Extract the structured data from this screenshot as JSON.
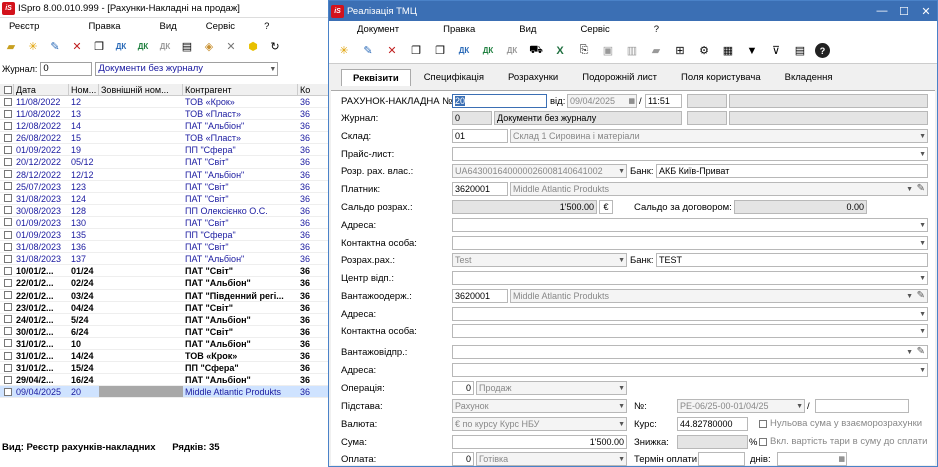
{
  "browse": {
    "title": "ISpro 8.00.010.999 - [Рахунки-Накладні на продаж]",
    "menu": [
      "Реєстр",
      "Правка",
      "Вид",
      "Сервіс",
      "?"
    ],
    "journal_label": "Журнал:",
    "journal_code": "0",
    "journal_name": "Документи без журналу",
    "columns": [
      "Дата",
      "Ном...",
      "Зовнішній ном...",
      "Контрагент",
      "Ко"
    ],
    "rows": [
      {
        "date": "11/08/2022",
        "num": "12",
        "ext": "",
        "contr": "ТОВ «Крок»",
        "ko": "36",
        "bold": false
      },
      {
        "date": "11/08/2022",
        "num": "13",
        "ext": "",
        "contr": "ТОВ «Пласт»",
        "ko": "36",
        "bold": false
      },
      {
        "date": "12/08/2022",
        "num": "14",
        "ext": "",
        "contr": "ПАТ \"Альбіон\"",
        "ko": "36",
        "bold": false
      },
      {
        "date": "26/08/2022",
        "num": "15",
        "ext": "",
        "contr": "ТОВ «Пласт»",
        "ko": "36",
        "bold": false
      },
      {
        "date": "01/09/2022",
        "num": "19",
        "ext": "",
        "contr": "ПП \"Сфера\"",
        "ko": "36",
        "bold": false
      },
      {
        "date": "20/12/2022",
        "num": "05/12",
        "ext": "",
        "contr": "ПАТ \"Світ\"",
        "ko": "36",
        "bold": false
      },
      {
        "date": "28/12/2022",
        "num": "12/12",
        "ext": "",
        "contr": "ПАТ \"Альбіон\"",
        "ko": "36",
        "bold": false
      },
      {
        "date": "25/07/2023",
        "num": "123",
        "ext": "",
        "contr": "ПАТ \"Світ\"",
        "ko": "36",
        "bold": false
      },
      {
        "date": "31/08/2023",
        "num": "124",
        "ext": "",
        "contr": "ПАТ \"Світ\"",
        "ko": "36",
        "bold": false
      },
      {
        "date": "30/08/2023",
        "num": "128",
        "ext": "",
        "contr": "ПП Олексієнко О.С.",
        "ko": "36",
        "bold": false
      },
      {
        "date": "01/09/2023",
        "num": "130",
        "ext": "",
        "contr": "ПАТ \"Світ\"",
        "ko": "36",
        "bold": false
      },
      {
        "date": "01/09/2023",
        "num": "135",
        "ext": "",
        "contr": "ПП \"Сфера\"",
        "ko": "36",
        "bold": false
      },
      {
        "date": "31/08/2023",
        "num": "136",
        "ext": "",
        "contr": "ПАТ \"Світ\"",
        "ko": "36",
        "bold": false
      },
      {
        "date": "31/08/2023",
        "num": "137",
        "ext": "",
        "contr": "ПАТ \"Альбіон\"",
        "ko": "36",
        "bold": false
      },
      {
        "date": "10/01/2...",
        "num": "01/24",
        "ext": "",
        "contr": "ПАТ \"Світ\"",
        "ko": "36",
        "bold": true
      },
      {
        "date": "22/01/2...",
        "num": "02/24",
        "ext": "",
        "contr": "ПАТ \"Альбіон\"",
        "ko": "36",
        "bold": true
      },
      {
        "date": "22/01/2...",
        "num": "03/24",
        "ext": "",
        "contr": "ПАТ \"Південний регі...",
        "ko": "36",
        "bold": true
      },
      {
        "date": "23/01/2...",
        "num": "04/24",
        "ext": "",
        "contr": "ПАТ \"Світ\"",
        "ko": "36",
        "bold": true
      },
      {
        "date": "24/01/2...",
        "num": "5/24",
        "ext": "",
        "contr": "ПАТ \"Альбіон\"",
        "ko": "36",
        "bold": true
      },
      {
        "date": "30/01/2...",
        "num": "6/24",
        "ext": "",
        "contr": "ПАТ \"Світ\"",
        "ko": "36",
        "bold": true
      },
      {
        "date": "31/01/2...",
        "num": "10",
        "ext": "",
        "contr": "ПАТ \"Альбіон\"",
        "ko": "36",
        "bold": true
      },
      {
        "date": "31/01/2...",
        "num": "14/24",
        "ext": "",
        "contr": "ТОВ «Крок»",
        "ko": "36",
        "bold": true
      },
      {
        "date": "31/01/2...",
        "num": "15/24",
        "ext": "",
        "contr": "ПП \"Сфера\"",
        "ko": "36",
        "bold": true
      },
      {
        "date": "29/04/2...",
        "num": "16/24",
        "ext": "",
        "contr": "ПАТ \"Альбіон\"",
        "ko": "36",
        "bold": true
      },
      {
        "date": "09/04/2025",
        "num": "20",
        "ext": "",
        "contr": "Middle Atlantic Produkts",
        "ko": "36",
        "bold": false,
        "sel": true
      }
    ],
    "status_view": "Вид: Реєстр рахунків-накладних",
    "status_rows": "Рядків: 35"
  },
  "form": {
    "title": "Реалізація ТМЦ",
    "menu": [
      "Документ",
      "Правка",
      "Вид",
      "Сервіс",
      "?"
    ],
    "tabs": [
      "Реквізити",
      "Специфікація",
      "Розрахунки",
      "Подорожній лист",
      "Поля користувача",
      "Вкладення"
    ],
    "invoice_label": "РАХУНОК-НАКЛАДНА №:",
    "invoice_no": "20",
    "from_label": "від:",
    "date": "09/04/2025",
    "time": "11:51",
    "journal_label": "Журнал:",
    "journal_code": "0",
    "journal_name": "Документи без журналу",
    "warehouse_label": "Склад:",
    "warehouse_code": "01",
    "warehouse_name": "Склад 1 Сировина і матеріали",
    "price_label": "Прайс-лист:",
    "account_label": "Розр. рах. влас.:",
    "account_value": "UA643001640000026008140641002",
    "bank_label": "Банк:",
    "bank_value": "АКБ Київ-Приват",
    "payer_label": "Платник:",
    "payer_code": "3620001",
    "payer_name": "Middle Atlantic Produkts",
    "saldo_label": "Сальдо розрах.:",
    "saldo_value": "1'500.00",
    "currency_sign": "€",
    "saldo_contract_label": "Сальдо за договором:",
    "saldo_contract_value": "0.00",
    "address_label": "Адреса:",
    "contact_label": "Контактна особа:",
    "calc_acc_label": "Розрах.рах.:",
    "calc_acc_value": "Test",
    "bank2_label": "Банк:",
    "bank2_value": "TEST",
    "resp_center_label": "Центр відп.:",
    "consignee_label": "Вантажоодерж.:",
    "consignee_code": "3620001",
    "consignee_name": "Middle Atlantic Produkts",
    "address2_label": "Адреса:",
    "contact2_label": "Контактна особа:",
    "shipper_label": "Вантажовідпр.:",
    "address3_label": "Адреса:",
    "operation_label": "Операція:",
    "operation_code": "0",
    "operation_name": "Продаж",
    "basis_label": "Підстава:",
    "basis_value": "Рахунок",
    "num_label": "№:",
    "num_value": "PE-06/25-00-01/04/25",
    "currency_label": "Валюта:",
    "currency_value": "€ по курсу Курс НБУ",
    "rate_label": "Курс:",
    "rate_value": "44.82780000",
    "zero_sum_label": "Нульова сума у взаєморозрахунки",
    "sum_label": "Сума:",
    "sum_value": "1'500.00",
    "discount_label": "Знижка:",
    "percent_sign": "%",
    "tare_label": "Вкл. вартість тари в суму до сплати",
    "payment_label": "Оплата:",
    "payment_code": "0",
    "payment_name": "Готівка",
    "term_label": "Термін оплати:",
    "days_label": "днів:"
  }
}
